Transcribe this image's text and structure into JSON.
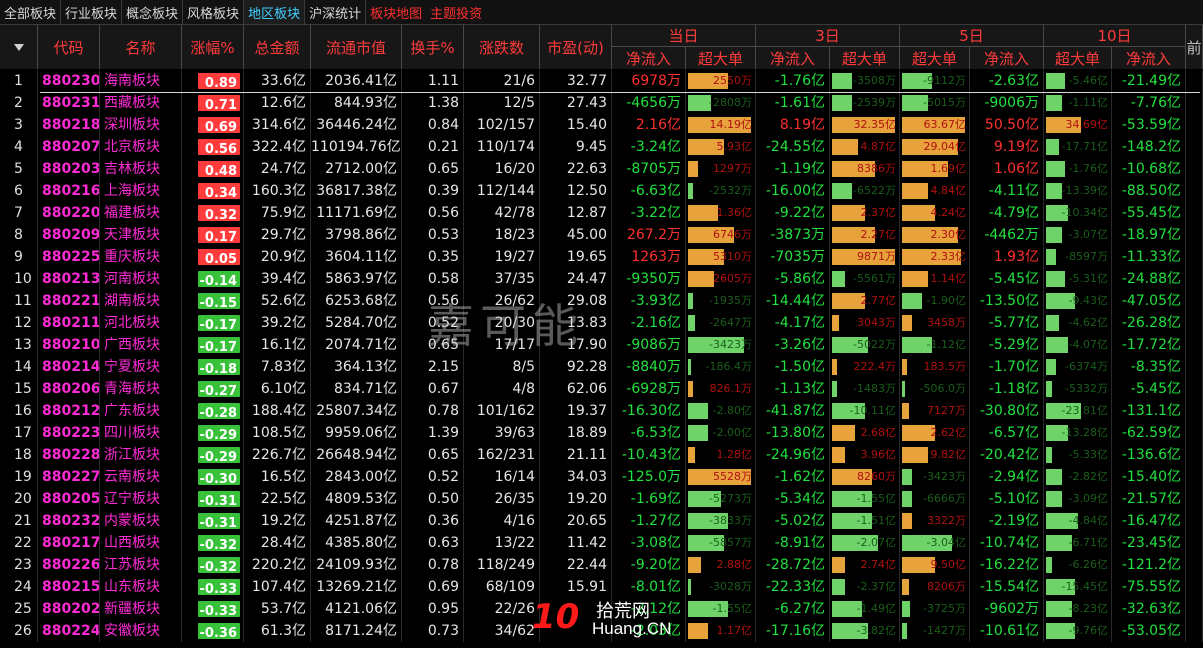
{
  "tabs": [
    "全部板块",
    "行业板块",
    "概念板块",
    "风格板块",
    "地区板块",
    "沪深统计",
    "板块地图",
    "主题投资"
  ],
  "active_tab": "地区板块",
  "headers": {
    "sort": "",
    "code": "代码",
    "name": "名称",
    "pct": "涨幅%",
    "amount": "总金额",
    "mktcap": "流通市值",
    "turnover": "换手%",
    "updown": "涨跌数",
    "pe": "市盈(动)",
    "extra": "前"
  },
  "groups": [
    {
      "label": "当日",
      "cols": [
        "净流入",
        "超大单"
      ]
    },
    {
      "label": "3日",
      "cols": [
        "净流入",
        "超大单"
      ]
    },
    {
      "label": "5日",
      "cols": [
        "超大单",
        "净流入"
      ]
    },
    {
      "label": "10日",
      "cols": [
        "超大单",
        "净流入"
      ]
    }
  ],
  "colors": {
    "up": "#ff3030",
    "down": "#22e040",
    "bar_orange": "#e8a23c",
    "bar_green": "#6ed46a",
    "code": "#ff2bd6"
  },
  "watermark": "嘉可能",
  "logo": {
    "big": "10",
    "top": "拾荒网",
    "bottom": "Huang.CN"
  },
  "rows": [
    {
      "i": "1",
      "code": "880230",
      "name": "海南板块",
      "pct": "0.89",
      "amt": "33.6亿",
      "cap": "2036.41亿",
      "to": "1.11",
      "ud": "21/6",
      "pe": "32.77",
      "d1": "6978万",
      "d1b": "2550万",
      "d1bf": 0.6,
      "d3": "-1.76亿",
      "d3b": "-3508万",
      "d3bf": 0.3,
      "d5b": "-9112万",
      "d5bf": 0.45,
      "d5": "-2.63亿",
      "d10b": "-5.46亿",
      "d10bf": 0.3,
      "d10": "-21.49亿"
    },
    {
      "i": "2",
      "code": "880231",
      "name": "西藏板块",
      "pct": "0.71",
      "amt": "12.6亿",
      "cap": "844.93亿",
      "to": "1.38",
      "ud": "12/5",
      "pe": "27.43",
      "d1": "-4656万",
      "d1b": "-2808万",
      "d1bf": 0.35,
      "d3": "-1.61亿",
      "d3b": "-2539万",
      "d3bf": 0.3,
      "d5b": "-5015万",
      "d5bf": 0.4,
      "d5": "-9006万",
      "d10b": "-1.11亿",
      "d10bf": 0.25,
      "d10": "-7.76亿"
    },
    {
      "i": "3",
      "code": "880218",
      "name": "深圳板块",
      "pct": "0.69",
      "amt": "314.6亿",
      "cap": "36446.24亿",
      "to": "0.84",
      "ud": "102/157",
      "pe": "15.40",
      "d1": "2.16亿",
      "d1b": "14.19亿",
      "d1bf": 0.95,
      "d3": "8.19亿",
      "d3b": "32.35亿",
      "d3bf": 0.95,
      "d5b": "63.67亿",
      "d5bf": 0.95,
      "d5": "50.50亿",
      "d10b": "34.69亿",
      "d10bf": 0.55,
      "d10": "-53.59亿"
    },
    {
      "i": "4",
      "code": "880207",
      "name": "北京板块",
      "pct": "0.56",
      "amt": "322.4亿",
      "cap": "110194.76亿",
      "to": "0.21",
      "ud": "110/174",
      "pe": "9.45",
      "d1": "-3.24亿",
      "d1b": "5.93亿",
      "d1bf": 0.55,
      "d3": "-24.55亿",
      "d3b": "4.87亿",
      "d3bf": 0.4,
      "d5b": "29.04亿",
      "d5bf": 0.85,
      "d5": "9.19亿",
      "d10b": "-17.71亿",
      "d10bf": 0.2,
      "d10": "-148.2亿"
    },
    {
      "i": "5",
      "code": "880203",
      "name": "吉林板块",
      "pct": "0.48",
      "amt": "24.7亿",
      "cap": "2712.00亿",
      "to": "0.65",
      "ud": "16/20",
      "pe": "22.63",
      "d1": "-8705万",
      "d1b": "1297万",
      "d1bf": 0.15,
      "d3": "-1.19亿",
      "d3b": "8386万",
      "d3bf": 0.65,
      "d5b": "1.69亿",
      "d5bf": 0.7,
      "d5": "1.06亿",
      "d10b": "-1.76亿",
      "d10bf": 0.3,
      "d10": "-10.68亿"
    },
    {
      "i": "6",
      "code": "880216",
      "name": "上海板块",
      "pct": "0.34",
      "amt": "160.3亿",
      "cap": "36817.38亿",
      "to": "0.39",
      "ud": "112/144",
      "pe": "12.50",
      "d1": "-6.63亿",
      "d1b": "-2532万",
      "d1bf": 0.08,
      "d3": "-16.00亿",
      "d3b": "-6522万",
      "d3bf": 0.3,
      "d5b": "4.84亿",
      "d5bf": 0.4,
      "d5": "-4.11亿",
      "d10b": "-13.39亿",
      "d10bf": 0.25,
      "d10": "-88.50亿"
    },
    {
      "i": "7",
      "code": "880220",
      "name": "福建板块",
      "pct": "0.32",
      "amt": "75.9亿",
      "cap": "11171.69亿",
      "to": "0.56",
      "ud": "42/78",
      "pe": "12.87",
      "d1": "-3.22亿",
      "d1b": "1.36亿",
      "d1bf": 0.45,
      "d3": "-9.22亿",
      "d3b": "2.37亿",
      "d3bf": 0.5,
      "d5b": "4.24亿",
      "d5bf": 0.5,
      "d5": "-4.79亿",
      "d10b": "-10.34亿",
      "d10bf": 0.35,
      "d10": "-55.45亿"
    },
    {
      "i": "8",
      "code": "880209",
      "name": "天津板块",
      "pct": "0.17",
      "amt": "29.7亿",
      "cap": "3798.86亿",
      "to": "0.53",
      "ud": "18/23",
      "pe": "45.00",
      "d1": "267.2万",
      "d1b": "6746万",
      "d1bf": 0.7,
      "d3": "-3873万",
      "d3b": "2.27亿",
      "d3bf": 0.65,
      "d5b": "2.30亿",
      "d5bf": 0.85,
      "d5": "-4462万",
      "d10b": "-3.07亿",
      "d10bf": 0.25,
      "d10": "-18.97亿"
    },
    {
      "i": "9",
      "code": "880225",
      "name": "重庆板块",
      "pct": "0.05",
      "amt": "20.9亿",
      "cap": "3604.11亿",
      "to": "0.35",
      "ud": "19/27",
      "pe": "19.65",
      "d1": "1263万",
      "d1b": "5310万",
      "d1bf": 0.55,
      "d3": "-7035万",
      "d3b": "9871万",
      "d3bf": 0.95,
      "d5b": "2.33亿",
      "d5bf": 0.9,
      "d5": "1.93亿",
      "d10b": "-8597万",
      "d10bf": 0.15,
      "d10": "-11.33亿"
    },
    {
      "i": "10",
      "code": "880213",
      "name": "河南板块",
      "pct": "-0.14",
      "amt": "39.4亿",
      "cap": "5863.97亿",
      "to": "0.58",
      "ud": "37/35",
      "pe": "24.47",
      "d1": "-9350万",
      "d1b": "2605万",
      "d1bf": 0.4,
      "d3": "-5.86亿",
      "d3b": "-5561万",
      "d3bf": 0.2,
      "d5b": "1.14亿",
      "d5bf": 0.4,
      "d5": "-5.45亿",
      "d10b": "-5.31亿",
      "d10bf": 0.3,
      "d10": "-24.88亿"
    },
    {
      "i": "11",
      "code": "880221",
      "name": "湖南板块",
      "pct": "-0.15",
      "amt": "52.6亿",
      "cap": "6253.68亿",
      "to": "0.56",
      "ud": "26/62",
      "pe": "29.08",
      "d1": "-3.93亿",
      "d1b": "-1935万",
      "d1bf": 0.08,
      "d3": "-14.44亿",
      "d3b": "2.77亿",
      "d3bf": 0.5,
      "d5b": "-1.90亿",
      "d5bf": 0.3,
      "d5": "-13.50亿",
      "d10b": "-9.43亿",
      "d10bf": 0.45,
      "d10": "-47.05亿"
    },
    {
      "i": "12",
      "code": "880211",
      "name": "河北板块",
      "pct": "-0.17",
      "amt": "39.2亿",
      "cap": "5284.70亿",
      "to": "0.52",
      "ud": "20/30",
      "pe": "13.83",
      "d1": "-2.16亿",
      "d1b": "-2647万",
      "d1bf": 0.1,
      "d3": "-4.17亿",
      "d3b": "3043万",
      "d3bf": 0.1,
      "d5b": "3458万",
      "d5bf": 0.15,
      "d5": "-5.77亿",
      "d10b": "-4.62亿",
      "d10bf": 0.2,
      "d10": "-26.28亿"
    },
    {
      "i": "13",
      "code": "880210",
      "name": "广西板块",
      "pct": "-0.17",
      "amt": "16.1亿",
      "cap": "2074.71亿",
      "to": "0.65",
      "ud": "17/17",
      "pe": "17.90",
      "d1": "-9086万",
      "d1b": "-3423万",
      "d1bf": 0.85,
      "d3": "-3.26亿",
      "d3b": "-5022万",
      "d3bf": 0.55,
      "d5b": "-1.12亿",
      "d5bf": 0.45,
      "d5": "-5.29亿",
      "d10b": "-4.07亿",
      "d10bf": 0.35,
      "d10": "-17.72亿"
    },
    {
      "i": "14",
      "code": "880214",
      "name": "宁夏板块",
      "pct": "-0.18",
      "amt": "7.83亿",
      "cap": "364.13亿",
      "to": "2.15",
      "ud": "8/5",
      "pe": "92.28",
      "d1": "-8840万",
      "d1b": "-186.4万",
      "d1bf": 0.05,
      "d3": "-1.50亿",
      "d3b": "222.4万",
      "d3bf": 0.08,
      "d5b": "183.5万",
      "d5bf": 0.08,
      "d5": "-1.70亿",
      "d10b": "-6374万",
      "d10bf": 0.15,
      "d10": "-8.35亿"
    },
    {
      "i": "15",
      "code": "880206",
      "name": "青海板块",
      "pct": "-0.27",
      "amt": "6.10亿",
      "cap": "834.71亿",
      "to": "0.67",
      "ud": "4/8",
      "pe": "62.06",
      "d1": "-6928万",
      "d1b": "826.1万",
      "d1bf": 0.08,
      "d3": "-1.13亿",
      "d3b": "-1483万",
      "d3bf": 0.08,
      "d5b": "-506.0万",
      "d5bf": 0.05,
      "d5": "-1.18亿",
      "d10b": "-5332万",
      "d10bf": 0.1,
      "d10": "-5.45亿"
    },
    {
      "i": "16",
      "code": "880212",
      "name": "广东板块",
      "pct": "-0.28",
      "amt": "188.4亿",
      "cap": "25807.34亿",
      "to": "0.78",
      "ud": "101/162",
      "pe": "19.37",
      "d1": "-16.30亿",
      "d1b": "-2.80亿",
      "d1bf": 0.3,
      "d3": "-41.87亿",
      "d3b": "-10.11亿",
      "d3bf": 0.5,
      "d5b": "7127万",
      "d5bf": 0.1,
      "d5": "-30.80亿",
      "d10b": "-23.81亿",
      "d10bf": 0.55,
      "d10": "-131.1亿"
    },
    {
      "i": "17",
      "code": "880223",
      "name": "四川板块",
      "pct": "-0.29",
      "amt": "108.5亿",
      "cap": "9959.06亿",
      "to": "1.39",
      "ud": "39/63",
      "pe": "18.89",
      "d1": "-6.53亿",
      "d1b": "-2.00亿",
      "d1bf": 0.3,
      "d3": "-13.80亿",
      "d3b": "2.68亿",
      "d3bf": 0.35,
      "d5b": "2.62亿",
      "d5bf": 0.5,
      "d5": "-6.57亿",
      "d10b": "-13.28亿",
      "d10bf": 0.35,
      "d10": "-62.59亿"
    },
    {
      "i": "18",
      "code": "880228",
      "name": "浙江板块",
      "pct": "-0.29",
      "amt": "226.7亿",
      "cap": "26648.94亿",
      "to": "0.65",
      "ud": "162/231",
      "pe": "21.11",
      "d1": "-10.43亿",
      "d1b": "1.28亿",
      "d1bf": 0.1,
      "d3": "-24.96亿",
      "d3b": "3.96亿",
      "d3bf": 0.2,
      "d5b": "9.82亿",
      "d5bf": 0.4,
      "d5": "-20.42亿",
      "d10b": "-5.33亿",
      "d10bf": 0.1,
      "d10": "-136.6亿"
    },
    {
      "i": "19",
      "code": "880227",
      "name": "云南板块",
      "pct": "-0.30",
      "amt": "16.5亿",
      "cap": "2843.00亿",
      "to": "0.52",
      "ud": "16/14",
      "pe": "34.03",
      "d1": "-125.0万",
      "d1b": "5528万",
      "d1bf": 0.95,
      "d3": "-1.62亿",
      "d3b": "8260万",
      "d3bf": 0.6,
      "d5b": "-3423万",
      "d5bf": 0.15,
      "d5": "-2.94亿",
      "d10b": "-2.82亿",
      "d10bf": 0.25,
      "d10": "-15.40亿"
    },
    {
      "i": "20",
      "code": "880205",
      "name": "辽宁板块",
      "pct": "-0.31",
      "amt": "22.5亿",
      "cap": "4809.53亿",
      "to": "0.50",
      "ud": "26/35",
      "pe": "19.20",
      "d1": "-1.69亿",
      "d1b": "-5273万",
      "d1bf": 0.5,
      "d3": "-5.34亿",
      "d3b": "-1.55亿",
      "d3bf": 0.6,
      "d5b": "-6666万",
      "d5bf": 0.15,
      "d5": "-5.10亿",
      "d10b": "-3.09亿",
      "d10bf": 0.25,
      "d10": "-21.57亿"
    },
    {
      "i": "21",
      "code": "880232",
      "name": "内蒙板块",
      "pct": "-0.31",
      "amt": "19.2亿",
      "cap": "4251.87亿",
      "to": "0.36",
      "ud": "4/16",
      "pe": "20.65",
      "d1": "-1.27亿",
      "d1b": "-3833万",
      "d1bf": 0.6,
      "d3": "-5.02亿",
      "d3b": "-1.51亿",
      "d3bf": 0.6,
      "d5b": "3322万",
      "d5bf": 0.15,
      "d5": "-2.19亿",
      "d10b": "-4.84亿",
      "d10bf": 0.5,
      "d10": "-16.47亿"
    },
    {
      "i": "22",
      "code": "880217",
      "name": "山西板块",
      "pct": "-0.32",
      "amt": "28.4亿",
      "cap": "4385.80亿",
      "to": "0.63",
      "ud": "13/22",
      "pe": "11.42",
      "d1": "-3.08亿",
      "d1b": "-5857万",
      "d1bf": 0.55,
      "d3": "-8.91亿",
      "d3b": "-2.07亿",
      "d3bf": 0.7,
      "d5b": "-3.04亿",
      "d5bf": 0.75,
      "d5": "-10.74亿",
      "d10b": "-6.71亿",
      "d10bf": 0.4,
      "d10": "-23.45亿"
    },
    {
      "i": "23",
      "code": "880226",
      "name": "江苏板块",
      "pct": "-0.32",
      "amt": "220.2亿",
      "cap": "24109.93亿",
      "to": "0.78",
      "ud": "118/249",
      "pe": "22.44",
      "d1": "-9.20亿",
      "d1b": "2.88亿",
      "d1bf": 0.2,
      "d3": "-28.72亿",
      "d3b": "2.74亿",
      "d3bf": 0.2,
      "d5b": "9.50亿",
      "d5bf": 0.5,
      "d5": "-16.22亿",
      "d10b": "-6.26亿",
      "d10bf": 0.1,
      "d10": "-121.2亿"
    },
    {
      "i": "24",
      "code": "880215",
      "name": "山东板块",
      "pct": "-0.33",
      "amt": "107.4亿",
      "cap": "13269.21亿",
      "to": "0.69",
      "ud": "68/109",
      "pe": "15.91",
      "d1": "-8.01亿",
      "d1b": "-3028万",
      "d1bf": 0.05,
      "d3": "-22.33亿",
      "d3b": "-2.37亿",
      "d3bf": 0.2,
      "d5b": "8206万",
      "d5bf": 0.1,
      "d5": "-15.54亿",
      "d10b": "-15.45亿",
      "d10bf": 0.45,
      "d10": "-75.55亿"
    },
    {
      "i": "25",
      "code": "880202",
      "name": "新疆板块",
      "pct": "-0.33",
      "amt": "53.7亿",
      "cap": "4121.06亿",
      "to": "0.95",
      "ud": "22/26",
      "pe": "",
      "d1": "-2.12亿",
      "d1b": "-1.55亿",
      "d1bf": 0.6,
      "d3": "-6.27亿",
      "d3b": "-1.49亿",
      "d3bf": 0.45,
      "d5b": "-3725万",
      "d5bf": 0.12,
      "d5": "-9602万",
      "d10b": "-8.23亿",
      "d10bf": 0.4,
      "d10": "-32.63亿"
    },
    {
      "i": "26",
      "code": "880224",
      "name": "安徽板块",
      "pct": "-0.36",
      "amt": "61.3亿",
      "cap": "8171.24亿",
      "to": "0.73",
      "ud": "34/62",
      "pe": "",
      "d1": "-2.03亿",
      "d1b": "1.17亿",
      "d1bf": 0.3,
      "d3": "-17.16亿",
      "d3b": "-3.82亿",
      "d3bf": 0.55,
      "d5b": "-1427万",
      "d5bf": 0.08,
      "d5": "-10.61亿",
      "d10b": "-9.76亿",
      "d10bf": 0.45,
      "d10": "-53.05亿"
    }
  ]
}
